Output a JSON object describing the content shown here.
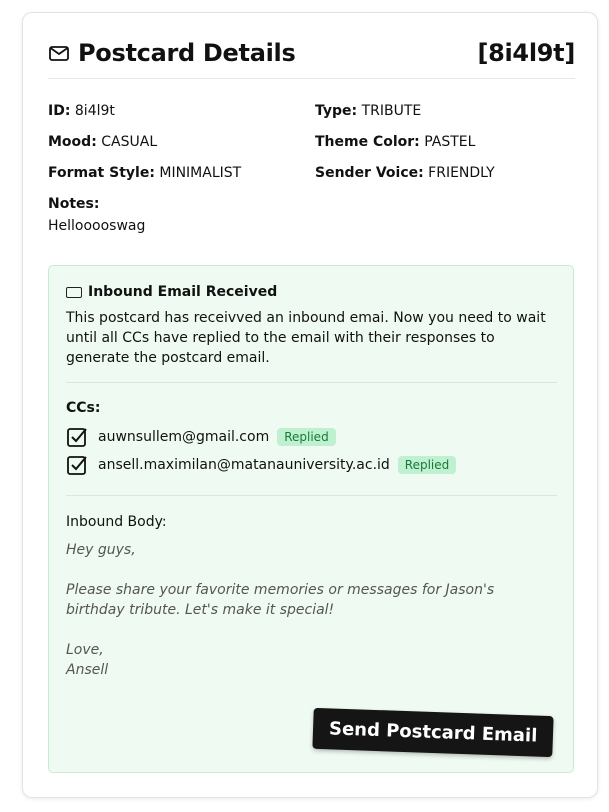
{
  "header": {
    "title": "Postcard Details",
    "id_badge": "[8i4l9t]"
  },
  "details": {
    "id_label": "ID:",
    "id_value": "8i4l9t",
    "type_label": "Type:",
    "type_value": "TRIBUTE",
    "mood_label": "Mood:",
    "mood_value": "CASUAL",
    "theme_label": "Theme Color:",
    "theme_value": "PASTEL",
    "format_label": "Format Style:",
    "format_value": "MINIMALIST",
    "voice_label": "Sender Voice:",
    "voice_value": "FRIENDLY",
    "notes_label": "Notes:",
    "notes_value": "Hellooooswag"
  },
  "inbound": {
    "title": "Inbound Email Received",
    "description": "This postcard has receivved an inbound emai. Now you need to wait until all CCs have replied to the email with their responses to generate the postcard email.",
    "ccs_label": "CCs:",
    "ccs": [
      {
        "email": "auwnsullem@gmail.com",
        "status": "Replied"
      },
      {
        "email": "ansell.maximilan@matanauniversity.ac.id",
        "status": "Replied"
      }
    ],
    "body_label": "Inbound Body:",
    "body_greeting": "Hey guys,",
    "body_message": "Please share your favorite memories or messages for Jason's birthday tribute. Let's make it special!",
    "body_closing": "Love,",
    "body_signature": "Ansell",
    "send_button": "Send Postcard Email"
  },
  "icons": {
    "header": "mail-icon",
    "inbound": "card-icon",
    "cc": "checkbox-checked-icon"
  },
  "colors": {
    "inbound_bg": "#effbf2",
    "inbound_border": "#c7ecd2",
    "badge_bg": "#bff0cf",
    "badge_text": "#177a3a",
    "button_bg": "#151515"
  }
}
